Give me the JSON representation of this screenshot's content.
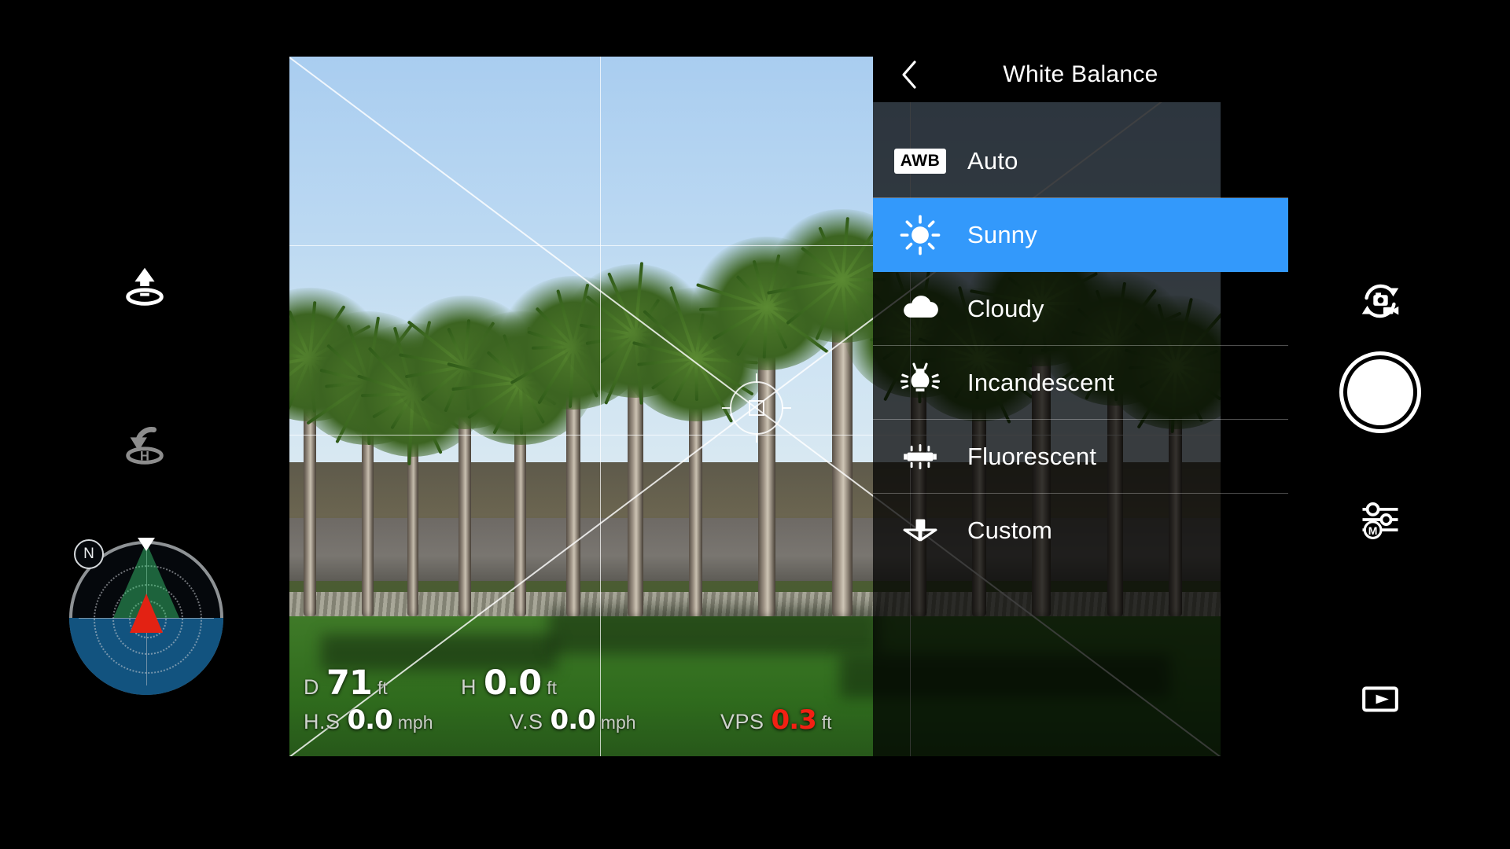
{
  "panel": {
    "title": "White Balance",
    "back_icon": "chevron-left-icon",
    "accent_color": "#3399FB",
    "items": [
      {
        "label": "Auto",
        "icon": "awb-badge-icon",
        "badge_text": "AWB",
        "selected": false
      },
      {
        "label": "Sunny",
        "icon": "sun-icon",
        "selected": true
      },
      {
        "label": "Cloudy",
        "icon": "cloud-icon",
        "selected": false
      },
      {
        "label": "Incandescent",
        "icon": "lightbulb-icon",
        "selected": false
      },
      {
        "label": "Fluorescent",
        "icon": "fluorescent-tube-icon",
        "selected": false
      },
      {
        "label": "Custom",
        "icon": "custom-wb-icon",
        "selected": false
      }
    ]
  },
  "telemetry": {
    "distance": {
      "label": "D",
      "value": "71",
      "unit": "ft"
    },
    "height": {
      "label": "H",
      "value": "0.0",
      "unit": "ft"
    },
    "horizontal_speed": {
      "label": "H.S",
      "value": "0.0",
      "unit": "mph"
    },
    "vertical_speed": {
      "label": "V.S",
      "value": "0.0",
      "unit": "mph"
    },
    "vps": {
      "label": "VPS",
      "value": "0.3",
      "unit": "ft",
      "color": "#F32013"
    }
  },
  "left_controls": [
    {
      "name": "takeoff-button",
      "icon": "takeoff-icon",
      "state": "enabled"
    },
    {
      "name": "return-to-home-button",
      "icon": "return-to-home-icon",
      "state": "disabled"
    }
  ],
  "right_controls": [
    {
      "name": "camera-video-toggle",
      "icon": "photo-video-switch-icon"
    },
    {
      "name": "shutter-button",
      "icon": "shutter-icon"
    },
    {
      "name": "camera-settings-button",
      "icon": "sliders-manual-icon"
    },
    {
      "name": "playback-button",
      "icon": "playback-icon"
    }
  ],
  "radar": {
    "north_label": "N",
    "heading_marker": "north-marker-icon",
    "aircraft_icon": "aircraft-arrow-icon",
    "fov_color": "#3CD278",
    "aircraft_color": "#E32213"
  }
}
